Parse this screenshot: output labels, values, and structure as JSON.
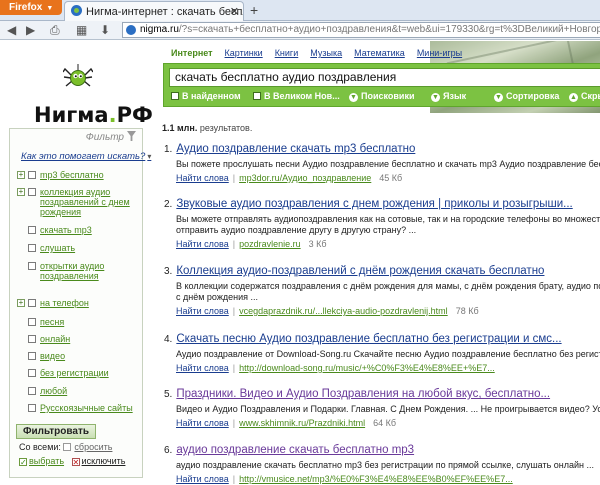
{
  "browser": {
    "app_button": "Firefox",
    "tab_title": "Нигма-интернет : скачать бесплатн...",
    "new_tab": "+",
    "url_host": "nigma.ru",
    "url_rest": "/?s=скачать+бесплатно+аудио+поздравления&t=web&ui=179330&rg=t%3DВеликий+Новгород_c%3DРоссия_&rg_v"
  },
  "logo": {
    "text_main": "Нигма",
    "text_dot": ".",
    "text_tld": "РФ"
  },
  "topnav": [
    "Интернет",
    "Картинки",
    "Книги",
    "Музыка",
    "Математика",
    "Мини-игры"
  ],
  "search": {
    "query": "скачать бесплатно аудио поздравления",
    "options": {
      "in_found": "В найденном",
      "in_region": "В Великом Нов...",
      "engines": "Поисковики",
      "language": "Язык",
      "sort": "Сортировка",
      "hide": "Скрыть"
    }
  },
  "results_count": {
    "num": "1.1 млн.",
    "suffix": " результатов."
  },
  "sidebar": {
    "filter_title": "Фильтр",
    "how_link": "Как это помогает искать?",
    "items": [
      {
        "label": "mp3 бесплатно"
      },
      {
        "label": "коллекция аудио поздравлений с днем рождения"
      },
      {
        "label": "скачать mp3"
      },
      {
        "label": "слушать"
      },
      {
        "label": "открытки аудио поздравления"
      },
      {
        "label": "на телефон"
      },
      {
        "label": "песня"
      },
      {
        "label": "онлайн"
      },
      {
        "label": "видео"
      },
      {
        "label": "без регистрации"
      },
      {
        "label": "любой"
      },
      {
        "label": "Русскоязычные сайты"
      }
    ],
    "filter_button": "Фильтровать",
    "all_label": "Со всеми:",
    "reset": "сбросить",
    "select": "выбрать",
    "exclude": "исключить"
  },
  "results": [
    {
      "num": "1.",
      "title": "Аудио поздравление скачать mp3 бесплатно",
      "snippet": "Вы пожете прослушать песни Аудио поздравление бесплатно и скачать mp3 Аудио поздравление бесплатно. Ко...",
      "find": "Найти слова",
      "url": "mp3dor.ru/Аудио_поздравление",
      "size": "45 Кб"
    },
    {
      "num": "2.",
      "title": "Звуковые аудио поздравления с днем рождения | приколы и розыгрыши...",
      "snippet": "Вы можете отправлять аудиопоздравления как на сотовые, так и на городские телефоны во множество стран...",
      "snippet2": "отправить аудио поздравление другу в другую страну? ...",
      "find": "Найти слова",
      "url": "pozdravlenie.ru",
      "size": "3 Кб"
    },
    {
      "num": "3.",
      "title": "Коллекция аудио-поздравлений с днём рождения скачать бесплатно",
      "snippet": "В коллекции содержатся поздравления с днём рождения для мамы, с днём рождения брату, аудио поздравле...",
      "snippet2": "с днём рождения ...",
      "find": "Найти слова",
      "url": "vcegdaprazdnik.ru/...llekciya-audio-pozdravlenij.html",
      "size": "78 Кб"
    },
    {
      "num": "4.",
      "title": "Скачать песню Аудио поздравление бесплатно без регистрации и смс...",
      "snippet": "Аудио поздравление от Download-Song.ru Скачайте песню Аудио поздравление бесплатно без регистрации и...",
      "find": "Найти слова",
      "url": "http://download-song.ru/music/+%C0%F3%E4%E8%EE+%E7...",
      "size": ""
    },
    {
      "num": "5.",
      "title": "Праздники. Видео и Аудио Поздравления на любой вкус, бесплатно...",
      "snippet": "Видео и Аудио Поздравления и Подарки. Главная. С Днем Рождения. ... Не проигрывается видео? Установи...",
      "find": "Найти слова",
      "url": "www.skhimnik.ru/Prazdniki.html",
      "size": "64 Кб"
    },
    {
      "num": "6.",
      "title": "аудио поздравление скачать бесплатно mp3",
      "snippet": "аудио поздравление скачать бесплатно mp3 без регистрации по прямой ссылке, слушать онлайн ...",
      "find": "Найти слова",
      "url": "http://vmusice.net/mp3/%E0%F3%E4%E8%EE%B0%EF%EE%E7...",
      "size": ""
    }
  ]
}
